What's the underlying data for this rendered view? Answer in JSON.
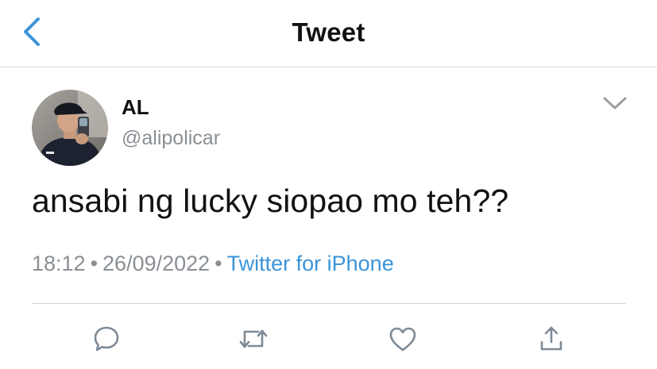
{
  "header": {
    "title": "Tweet",
    "back_icon": "chevron-left-icon",
    "accent_color": "#3b94d9"
  },
  "author": {
    "name": "AL",
    "handle": "@alipolicar",
    "avatar_icon": "avatar-photo",
    "more_icon": "chevron-down-icon"
  },
  "tweet": {
    "text": "ansabi ng lucky siopao mo teh??",
    "time": "18:12",
    "separator": "•",
    "date": "26/09/2022",
    "source": "Twitter for iPhone"
  },
  "actions": [
    {
      "icon": "reply-icon"
    },
    {
      "icon": "retweet-icon"
    },
    {
      "icon": "like-icon"
    },
    {
      "icon": "share-icon"
    }
  ],
  "colors": {
    "text": "#111111",
    "muted": "#8a8f94",
    "link": "#3b94d9",
    "divider": "#d6d6d6"
  }
}
